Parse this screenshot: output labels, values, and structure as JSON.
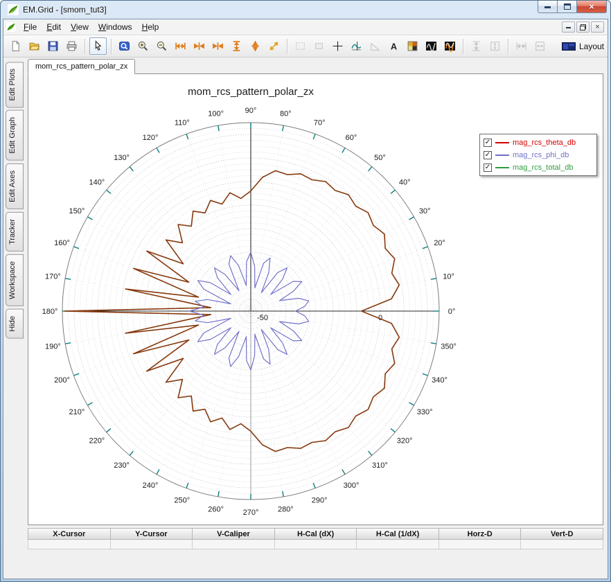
{
  "window": {
    "title": "EM.Grid - [smom_tut3]",
    "controls": {
      "close": "×"
    }
  },
  "menu": {
    "items": [
      {
        "label": "File",
        "accel": "F",
        "rest": "ile"
      },
      {
        "label": "Edit",
        "accel": "E",
        "rest": "dit"
      },
      {
        "label": "View",
        "accel": "V",
        "rest": "iew"
      },
      {
        "label": "Windows",
        "accel": "W",
        "rest": "indows"
      },
      {
        "label": "Help",
        "accel": "H",
        "rest": "elp"
      }
    ]
  },
  "toolbar": {
    "layout_label": "Layout",
    "text_tool_glyph": "A"
  },
  "sidebar": {
    "tabs": [
      "Edit Plots",
      "Edit Graph",
      "Edit Axes",
      "Tracker",
      "Workspace",
      "Hide"
    ]
  },
  "document_tab": "mom_rcs_pattern_polar_zx",
  "legend": {
    "check_glyph": "✓"
  },
  "chart_data": {
    "type": "line",
    "projection": "polar",
    "title": "mom_rcs_pattern_polar_zx",
    "angle_unit": "deg",
    "angle_start": 0,
    "angle_step": 5,
    "r_min": -55,
    "r_max": 25,
    "r_tick_labels": [
      -50,
      0
    ],
    "grid_circle_step_db": 2.5,
    "angle_tick_step": 10,
    "angle_label_step": 10,
    "series": [
      {
        "name": "mag_rcs_theta_db",
        "legend_color": "#d40000",
        "plot_color": "#8a3a10",
        "width": 1.6,
        "checked": true,
        "values": [
          -8,
          5,
          9,
          7,
          10,
          8,
          10.5,
          8.5,
          10,
          8,
          9.5,
          7.5,
          8.5,
          6.5,
          7,
          5,
          5.5,
          2,
          -4,
          -7,
          -4,
          -8,
          -5,
          -9,
          -6,
          -11,
          -7,
          -14,
          -8,
          -20,
          -4,
          -26,
          -2,
          -32,
          -1,
          -38,
          24,
          -38,
          -1,
          -32,
          -2,
          -26,
          -4,
          -20,
          -8,
          -14,
          -7,
          -11,
          -6,
          -9,
          -5,
          -8,
          -4,
          -7,
          -4,
          2,
          5.5,
          5,
          7,
          6.5,
          8.5,
          7.5,
          9.5,
          8,
          10,
          8.5,
          10.5,
          8,
          10,
          7,
          9,
          5
        ]
      },
      {
        "name": "mag_rcs_phi_db",
        "legend_color": "#7070cc",
        "plot_color": "#7272cc",
        "width": 1.2,
        "checked": true,
        "values": [
          -36,
          -32,
          -30,
          -34,
          -42,
          -35,
          -30,
          -33,
          -44,
          -36,
          -31,
          -35,
          -46,
          -37,
          -31,
          -34,
          -45,
          -36,
          -30,
          -34,
          -44,
          -35,
          -30,
          -33,
          -45,
          -36,
          -31,
          -35,
          -44,
          -34,
          -29,
          -33,
          -46,
          -36,
          -31,
          -35,
          -29,
          -35,
          -31,
          -36,
          -46,
          -33,
          -29,
          -34,
          -44,
          -35,
          -31,
          -36,
          -45,
          -33,
          -30,
          -35,
          -44,
          -34,
          -30,
          -36,
          -45,
          -34,
          -31,
          -37,
          -46,
          -35,
          -31,
          -36,
          -44,
          -33,
          -30,
          -35,
          -42,
          -34,
          -30,
          -32
        ]
      },
      {
        "name": "mag_rcs_total_db",
        "legend_color": "#2f9e3f",
        "plot_color": "#2f9e3f",
        "width": 1.2,
        "checked": true,
        "values": [
          -8,
          5,
          9,
          7,
          10,
          8,
          10.5,
          8.5,
          10,
          8,
          9.5,
          7.5,
          8.5,
          6.5,
          7,
          5,
          5.5,
          2,
          -4,
          -7,
          -4,
          -8,
          -5,
          -9,
          -6,
          -11,
          -7,
          -14,
          -8,
          -20,
          -4,
          -26,
          -2,
          -32,
          -1,
          -38,
          24,
          -38,
          -1,
          -32,
          -2,
          -26,
          -4,
          -20,
          -8,
          -14,
          -7,
          -11,
          -6,
          -9,
          -5,
          -8,
          -4,
          -7,
          -4,
          2,
          5.5,
          5,
          7,
          6.5,
          8.5,
          7.5,
          9.5,
          8,
          10,
          8.5,
          10.5,
          8,
          10,
          7,
          9,
          5
        ]
      }
    ]
  },
  "statusbar": {
    "columns": [
      "X-Cursor",
      "Y-Cursor",
      "V-Caliper",
      "H-Cal (dX)",
      "H-Cal (1/dX)",
      "Horz-D",
      "Vert-D"
    ],
    "values": [
      "",
      "",
      "",
      "",
      "",
      "",
      ""
    ]
  }
}
